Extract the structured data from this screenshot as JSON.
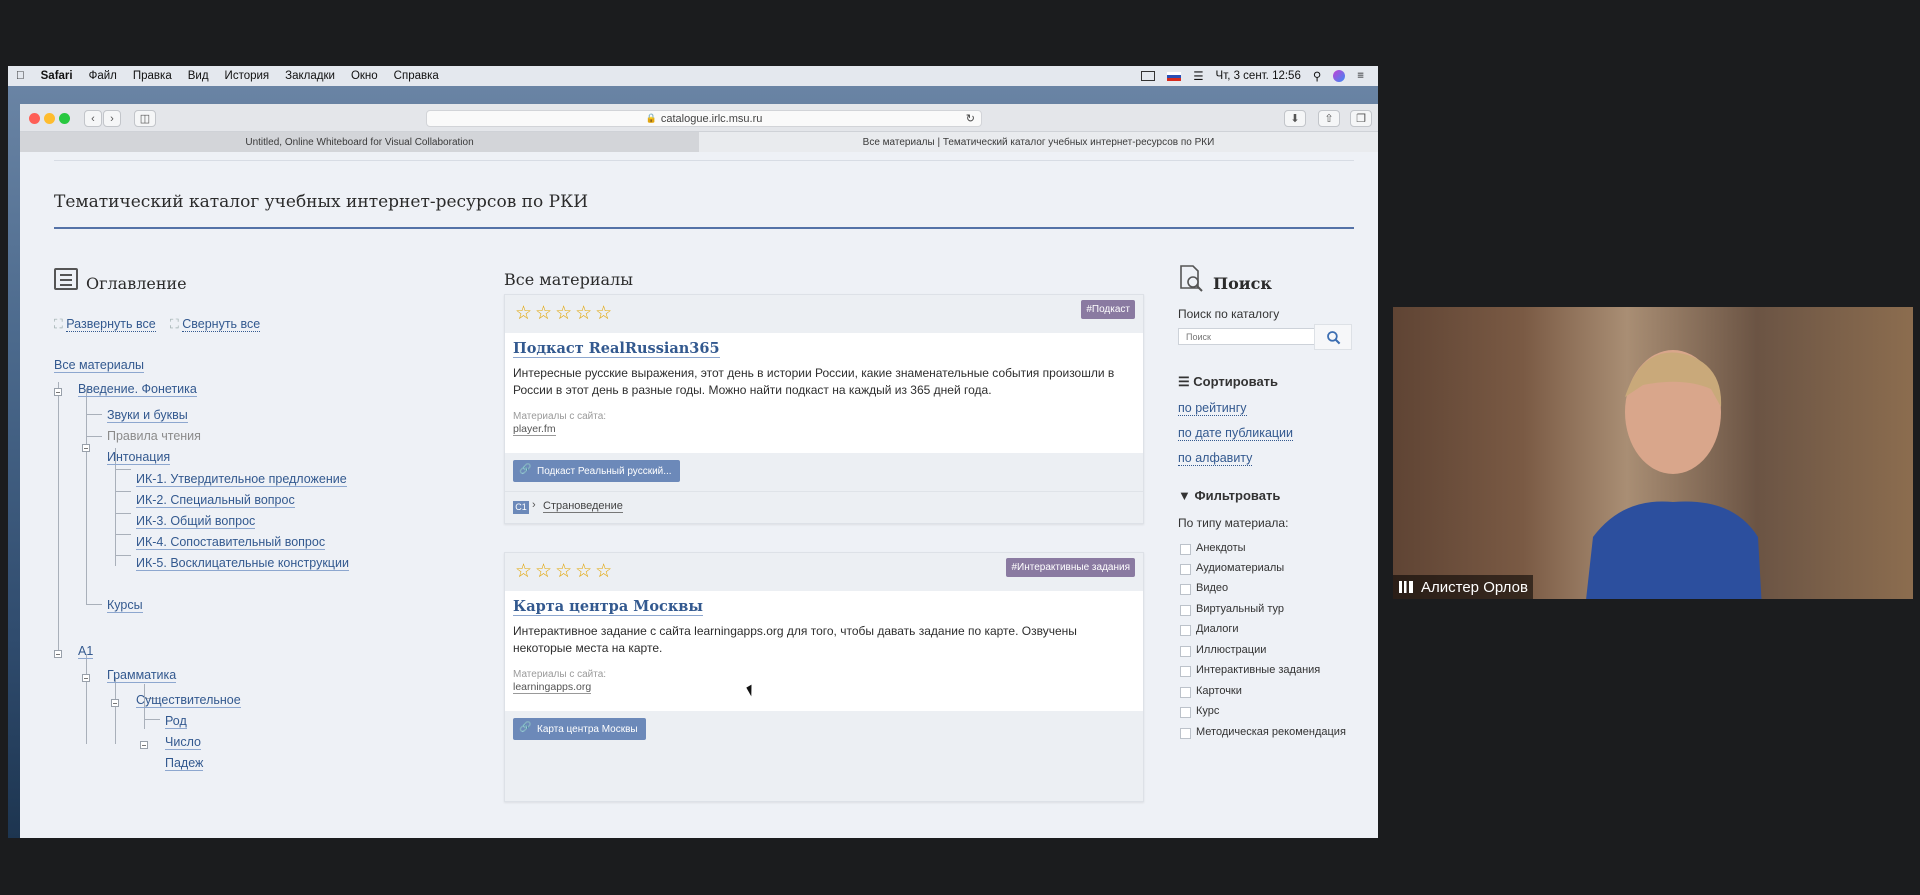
{
  "menubar": {
    "app": "Safari",
    "items": [
      "Файл",
      "Правка",
      "Вид",
      "История",
      "Закладки",
      "Окно",
      "Справка"
    ],
    "datetime": "Чт, 3 сент. 12:56"
  },
  "browser": {
    "url": "catalogue.irlc.msu.ru",
    "tabs": [
      {
        "label": "Untitled, Online Whiteboard for Visual Collaboration",
        "active": false
      },
      {
        "label": "Все материалы | Тематический каталог учебных интернет-ресурсов по РКИ",
        "active": true
      }
    ]
  },
  "site": {
    "title": "Тематический каталог учебных интернет-ресурсов по РКИ"
  },
  "toc": {
    "heading": "Оглавление",
    "expand_all": "Развернуть все",
    "collapse_all": "Свернуть все",
    "items": [
      "Все материалы",
      "Введение. Фонетика",
      "Звуки и буквы",
      "Правила чтения",
      "Интонация",
      "ИК-1. Утвердительное предложение",
      "ИК-2. Специальный вопрос",
      "ИК-3. Общий вопрос",
      "ИК-4. Сопоставительный вопрос",
      "ИК-5. Восклицательные конструкции",
      "Курсы",
      "A1",
      "Грамматика",
      "Существительное",
      "Род",
      "Число",
      "Падеж"
    ]
  },
  "main": {
    "heading": "Все материалы",
    "source_label": "Материалы с сайта:",
    "cards": [
      {
        "stars": "☆☆☆☆☆",
        "tag": "#Подкаст",
        "title": "Подкаст RealRussian365",
        "description": "Интересные русские выражения, этот день в истории России, какие знаменательные события произошли в России в этот день в разные годы. Можно найти подкаст на каждый из 365 дней года.",
        "site": "player.fm",
        "link": "Подкаст Реальный русский...",
        "level": "C1",
        "topic": "Страноведение"
      },
      {
        "stars": "☆☆☆☆☆",
        "tag": "#Интерактивные задания",
        "title": "Карта центра Москвы",
        "description": "Интерактивное задание с сайта learningapps.org для того, чтобы давать задание по карте. Озвучены некоторые места на карте.",
        "site": "learningapps.org",
        "link": "Карта центра Москвы"
      }
    ]
  },
  "sidebar": {
    "search_heading": "Поиск",
    "search_label": "Поиск по каталогу",
    "search_placeholder": "Поиск",
    "sort_heading": "Сортировать",
    "sort_options": [
      "по рейтингу",
      "по дате публикации",
      "по алфавиту"
    ],
    "filter_heading": "Фильтровать",
    "filter_label": "По типу материала:",
    "filter_types": [
      "Анекдоты",
      "Аудиоматериалы",
      "Видео",
      "Виртуальный тур",
      "Диалоги",
      "Иллюстрации",
      "Интерактивные задания",
      "Карточки",
      "Курс",
      "Методическая рекомендация"
    ]
  },
  "video": {
    "participant_name": "Алистер Орлов"
  },
  "dock": {
    "apps": [
      "finder-icon",
      "launchpad-icon",
      "safari-icon",
      "preview-icon",
      "photos-icon",
      "whatsapp-icon",
      "zoom-icon",
      "wechat-icon",
      "music-icon",
      "files-icon",
      "settings-icon",
      "onenote-icon",
      "powerpoint-icon",
      "excel-icon",
      "word-icon",
      "outlook-icon",
      "trash-icon"
    ]
  },
  "colors": {
    "link": "#33598f",
    "accent_rule": "#5472a7",
    "tag": "#8a7aa1",
    "button": "#6c89b9",
    "star": "#e2a400"
  }
}
